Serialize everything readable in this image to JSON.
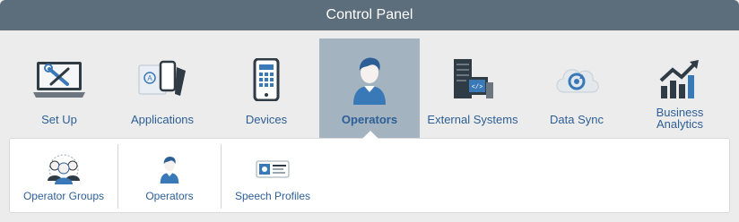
{
  "window": {
    "title": "Control Panel"
  },
  "nav": {
    "items": [
      {
        "label": "Set Up",
        "icon": "tools-laptop-icon"
      },
      {
        "label": "Applications",
        "icon": "applications-icon"
      },
      {
        "label": "Devices",
        "icon": "phone-icon"
      },
      {
        "label": "Operators",
        "icon": "operator-icon",
        "active": true
      },
      {
        "label": "External Systems",
        "icon": "server-icon"
      },
      {
        "label": "Data Sync",
        "icon": "cloud-sync-icon"
      },
      {
        "label": "Business Analytics",
        "icon": "analytics-chart-icon"
      }
    ]
  },
  "subnav": {
    "items": [
      {
        "label": "Operator Groups",
        "icon": "operator-groups-icon"
      },
      {
        "label": "Operators",
        "icon": "operator-icon"
      },
      {
        "label": "Speech Profiles",
        "icon": "speech-profile-icon"
      }
    ]
  },
  "colors": {
    "titlebar": "#5c6d7b",
    "active_tab": "#a3b3c0",
    "label": "#2d5f96",
    "icon_dark": "#2f3b45",
    "icon_blue": "#3a79b8"
  }
}
